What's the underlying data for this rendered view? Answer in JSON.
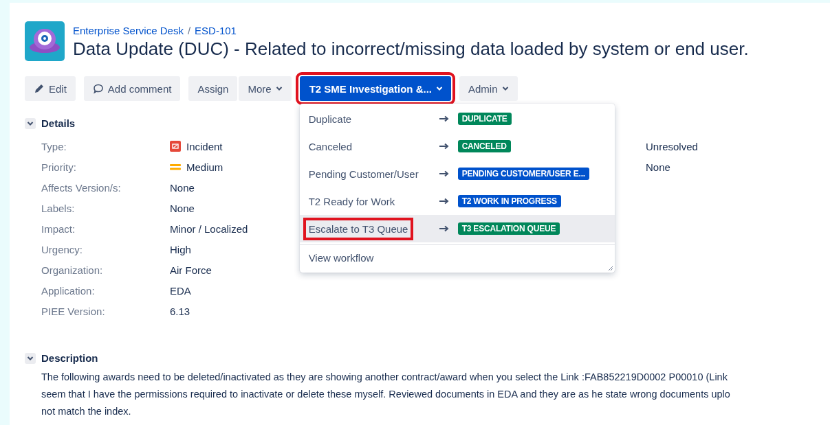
{
  "header": {
    "breadcrumb": [
      {
        "label": "Enterprise Service Desk"
      },
      {
        "label": "ESD-101"
      }
    ],
    "separator": "/",
    "title": "Data Update (DUC) - Related to incorrect/missing data loaded by system or end user."
  },
  "toolbar": [
    {
      "label": "Edit",
      "kind": "edit",
      "highlighted": false
    },
    {
      "label": "Add comment",
      "kind": "comment",
      "highlighted": false
    },
    {
      "label": "Assign",
      "kind": "plain",
      "highlighted": false
    },
    {
      "label": "More",
      "kind": "dropdown",
      "highlighted": false
    },
    {
      "label": "T2 SME Investigation &...",
      "kind": "primary",
      "highlighted": true,
      "expanded": true
    },
    {
      "label": "Admin",
      "kind": "dropdown",
      "highlighted": false
    }
  ],
  "transition_menu": {
    "items": [
      {
        "label": "Duplicate",
        "status": "DUPLICATE",
        "color": "#00875a",
        "hovered": false,
        "highlighted": false
      },
      {
        "label": "Canceled",
        "status": "CANCELED",
        "color": "#00875a",
        "hovered": false,
        "highlighted": false
      },
      {
        "label": "Pending Customer/User",
        "status": "PENDING CUSTOMER/USER E...",
        "color": "#0052cc",
        "hovered": false,
        "highlighted": false
      },
      {
        "label": "T2 Ready for Work",
        "status": "T2 WORK IN PROGRESS",
        "color": "#0052cc",
        "hovered": false,
        "highlighted": false
      },
      {
        "label": "Escalate to T3 Queue",
        "status": "T3 ESCALATION QUEUE",
        "color": "#00875a",
        "hovered": true,
        "highlighted": true
      }
    ],
    "footer": "View workflow"
  },
  "details": {
    "heading": "Details",
    "expanded": true,
    "fields": [
      {
        "label": "Type:",
        "value": "Incident",
        "kind": "incident",
        "side_value": "Unresolved"
      },
      {
        "label": "Priority:",
        "value": "Medium",
        "kind": "medium",
        "side_value": "None"
      },
      {
        "label": "Affects Version/s:",
        "value": "None",
        "kind": "plain"
      },
      {
        "label": "Labels:",
        "value": "None",
        "kind": "plain"
      },
      {
        "label": "Impact:",
        "value": "Minor / Localized",
        "kind": "plain"
      },
      {
        "label": "Urgency:",
        "value": "High",
        "kind": "plain"
      },
      {
        "label": "Organization:",
        "value": "Air Force",
        "kind": "plain"
      },
      {
        "label": "Application:",
        "value": "EDA",
        "kind": "plain"
      },
      {
        "label": "PIEE Version:",
        "value": "6.13",
        "kind": "plain"
      }
    ]
  },
  "description": {
    "heading": "Description",
    "expanded": true,
    "lines": [
      "The following awards need to be deleted/inactivated as they are showing another contract/award when you select the Link :FAB852219D0002 P00010 (Link",
      "seem that I have the permissions required to inactivate or delete these myself. Reviewed documents in EDA and they are as he state wrong documents uplo",
      "not match the index."
    ]
  }
}
